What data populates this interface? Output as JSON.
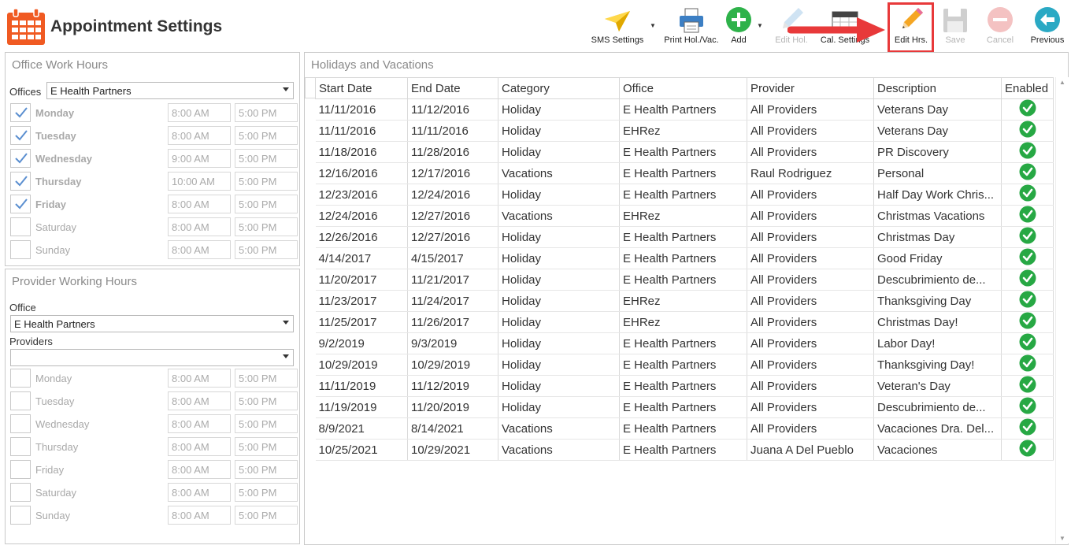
{
  "app": {
    "title": "Appointment Settings"
  },
  "toolbar": {
    "sms_settings": "SMS Settings",
    "print_hol_vac": "Print Hol./Vac.",
    "add": "Add",
    "edit_hol": "Edit Hol.",
    "cal_settings": "Cal. Settings",
    "edit_hrs": "Edit Hrs.",
    "save": "Save",
    "cancel": "Cancel",
    "previous": "Previous"
  },
  "office_work_hours": {
    "title": "Office Work Hours",
    "offices_label": "Offices",
    "office_value": "E Health Partners",
    "days": [
      {
        "name": "Monday",
        "checked": true,
        "start": "8:00 AM",
        "end": "5:00 PM"
      },
      {
        "name": "Tuesday",
        "checked": true,
        "start": "8:00 AM",
        "end": "5:00 PM"
      },
      {
        "name": "Wednesday",
        "checked": true,
        "start": "9:00 AM",
        "end": "5:00 PM"
      },
      {
        "name": "Thursday",
        "checked": true,
        "start": "10:00 AM",
        "end": "5:00 PM"
      },
      {
        "name": "Friday",
        "checked": true,
        "start": "8:00 AM",
        "end": "5:00 PM"
      },
      {
        "name": "Saturday",
        "checked": false,
        "start": "8:00 AM",
        "end": "5:00 PM"
      },
      {
        "name": "Sunday",
        "checked": false,
        "start": "8:00 AM",
        "end": "5:00 PM"
      }
    ]
  },
  "provider_working_hours": {
    "title": "Provider Working Hours",
    "office_label": "Office",
    "office_value": "E Health Partners",
    "providers_label": "Providers",
    "providers_value": "",
    "days": [
      {
        "name": "Monday",
        "start": "8:00 AM",
        "end": "5:00 PM"
      },
      {
        "name": "Tuesday",
        "start": "8:00 AM",
        "end": "5:00 PM"
      },
      {
        "name": "Wednesday",
        "start": "8:00 AM",
        "end": "5:00 PM"
      },
      {
        "name": "Thursday",
        "start": "8:00 AM",
        "end": "5:00 PM"
      },
      {
        "name": "Friday",
        "start": "8:00 AM",
        "end": "5:00 PM"
      },
      {
        "name": "Saturday",
        "start": "8:00 AM",
        "end": "5:00 PM"
      },
      {
        "name": "Sunday",
        "start": "8:00 AM",
        "end": "5:00 PM"
      }
    ]
  },
  "holidays": {
    "title": "Holidays and Vacations",
    "columns": [
      "Start Date",
      "End Date",
      "Category",
      "Office",
      "Provider",
      "Description",
      "Enabled"
    ],
    "rows": [
      [
        "11/11/2016",
        "11/12/2016",
        "Holiday",
        "E Health Partners",
        "All Providers",
        "Veterans Day"
      ],
      [
        "11/11/2016",
        "11/11/2016",
        "Holiday",
        "EHRez",
        "All Providers",
        "Veterans Day"
      ],
      [
        "11/18/2016",
        "11/28/2016",
        "Holiday",
        "E Health Partners",
        "All Providers",
        "PR Discovery"
      ],
      [
        "12/16/2016",
        "12/17/2016",
        "Vacations",
        "E Health Partners",
        "Raul Rodriguez",
        "Personal"
      ],
      [
        "12/23/2016",
        "12/24/2016",
        "Holiday",
        "E Health Partners",
        "All Providers",
        "Half Day Work Chris..."
      ],
      [
        "12/24/2016",
        "12/27/2016",
        "Vacations",
        "EHRez",
        "All Providers",
        "Christmas Vacations"
      ],
      [
        "12/26/2016",
        "12/27/2016",
        "Holiday",
        "E Health Partners",
        "All Providers",
        "Christmas Day"
      ],
      [
        "4/14/2017",
        "4/15/2017",
        "Holiday",
        "E Health Partners",
        "All Providers",
        "Good Friday"
      ],
      [
        "11/20/2017",
        "11/21/2017",
        "Holiday",
        "E Health Partners",
        "All Providers",
        "Descubrimiento de..."
      ],
      [
        "11/23/2017",
        "11/24/2017",
        "Holiday",
        "EHRez",
        "All Providers",
        "Thanksgiving Day"
      ],
      [
        "11/25/2017",
        "11/26/2017",
        "Holiday",
        "EHRez",
        "All Providers",
        "Christmas Day!"
      ],
      [
        "9/2/2019",
        "9/3/2019",
        "Holiday",
        "E Health Partners",
        "All Providers",
        "Labor Day!"
      ],
      [
        "10/29/2019",
        "10/29/2019",
        "Holiday",
        "E Health Partners",
        "All Providers",
        "Thanksgiving Day!"
      ],
      [
        "11/11/2019",
        "11/12/2019",
        "Holiday",
        "E Health Partners",
        "All Providers",
        "Veteran's Day"
      ],
      [
        "11/19/2019",
        "11/20/2019",
        "Holiday",
        "E Health Partners",
        "All Providers",
        "Descubrimiento de..."
      ],
      [
        "8/9/2021",
        "8/14/2021",
        "Vacations",
        "E Health Partners",
        "All Providers",
        "Vacaciones Dra. Del..."
      ],
      [
        "10/25/2021",
        "10/29/2021",
        "Vacations",
        "E Health Partners",
        "Juana A Del Pueblo",
        "Vacaciones"
      ]
    ]
  },
  "colors": {
    "accent_orange": "#f05a22",
    "enabled_green": "#27a844",
    "highlight_red": "#e8393a",
    "add_green": "#2eb24a",
    "previous_teal": "#2aa9c4",
    "disabled_gray": "#c9c9c9"
  }
}
